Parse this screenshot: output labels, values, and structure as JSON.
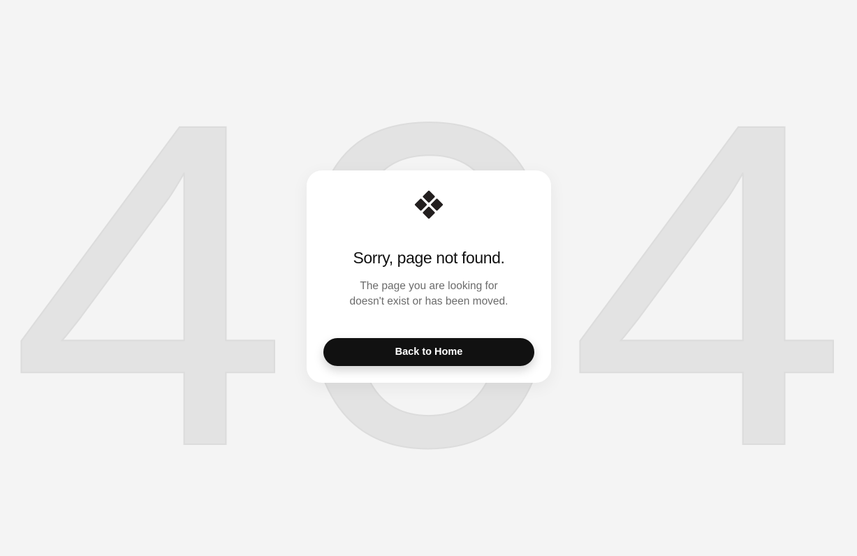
{
  "background": {
    "code": "404",
    "code_color": "#e3e3e3"
  },
  "card": {
    "logo_icon": "diamond-cluster-icon",
    "title": "Sorry, page not found.",
    "subtitle_line1": "The page you are looking for",
    "subtitle_line2": "doesn't exist or has been moved.",
    "button_label": "Back to Home",
    "button_color": "#111111"
  }
}
